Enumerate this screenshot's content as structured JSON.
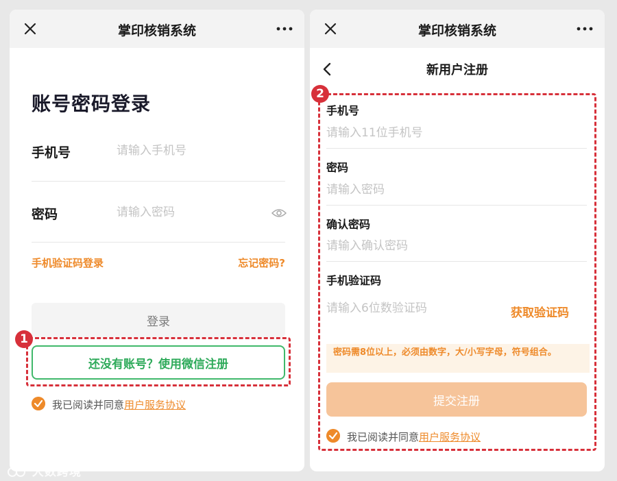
{
  "left_screen": {
    "window_title": "掌印核销系统",
    "heading": "账号密码登录",
    "phone_label": "手机号",
    "phone_placeholder": "请输入手机号",
    "password_label": "密码",
    "password_placeholder": "请输入密码",
    "sms_login_link": "手机验证码登录",
    "forgot_password_link": "忘记密码?",
    "login_button": "登录",
    "step_badge": "1",
    "wechat_register_button": "还没有账号？使用微信注册",
    "agreement_prefix": "我已阅读并同意",
    "agreement_link": "用户服务协议"
  },
  "right_screen": {
    "window_title": "掌印核销系统",
    "page_title": "新用户注册",
    "step_badge": "2",
    "fields": [
      {
        "label": "手机号",
        "placeholder": "请输入11位手机号"
      },
      {
        "label": "密码",
        "placeholder": "请输入密码"
      },
      {
        "label": "确认密码",
        "placeholder": "请输入确认密码"
      },
      {
        "label": "手机验证码",
        "placeholder": "请输入6位数验证码"
      }
    ],
    "get_code_button": "获取验证码",
    "password_hint": "密码需8位以上，必须由数字，大/小写字母，符号组合。",
    "submit_button": "提交注册",
    "agreement_prefix": "我已阅读并同意",
    "agreement_link": "用户服务协议"
  },
  "watermark": "大数跨境",
  "colors": {
    "accent_orange": "#ee8a2a",
    "wechat_green": "#2eaa5a",
    "annotation_red": "#d7303a",
    "submit_disabled": "#f6c49a"
  },
  "icons": [
    "close-icon",
    "more-icon",
    "eye-icon",
    "check-icon",
    "back-icon"
  ]
}
